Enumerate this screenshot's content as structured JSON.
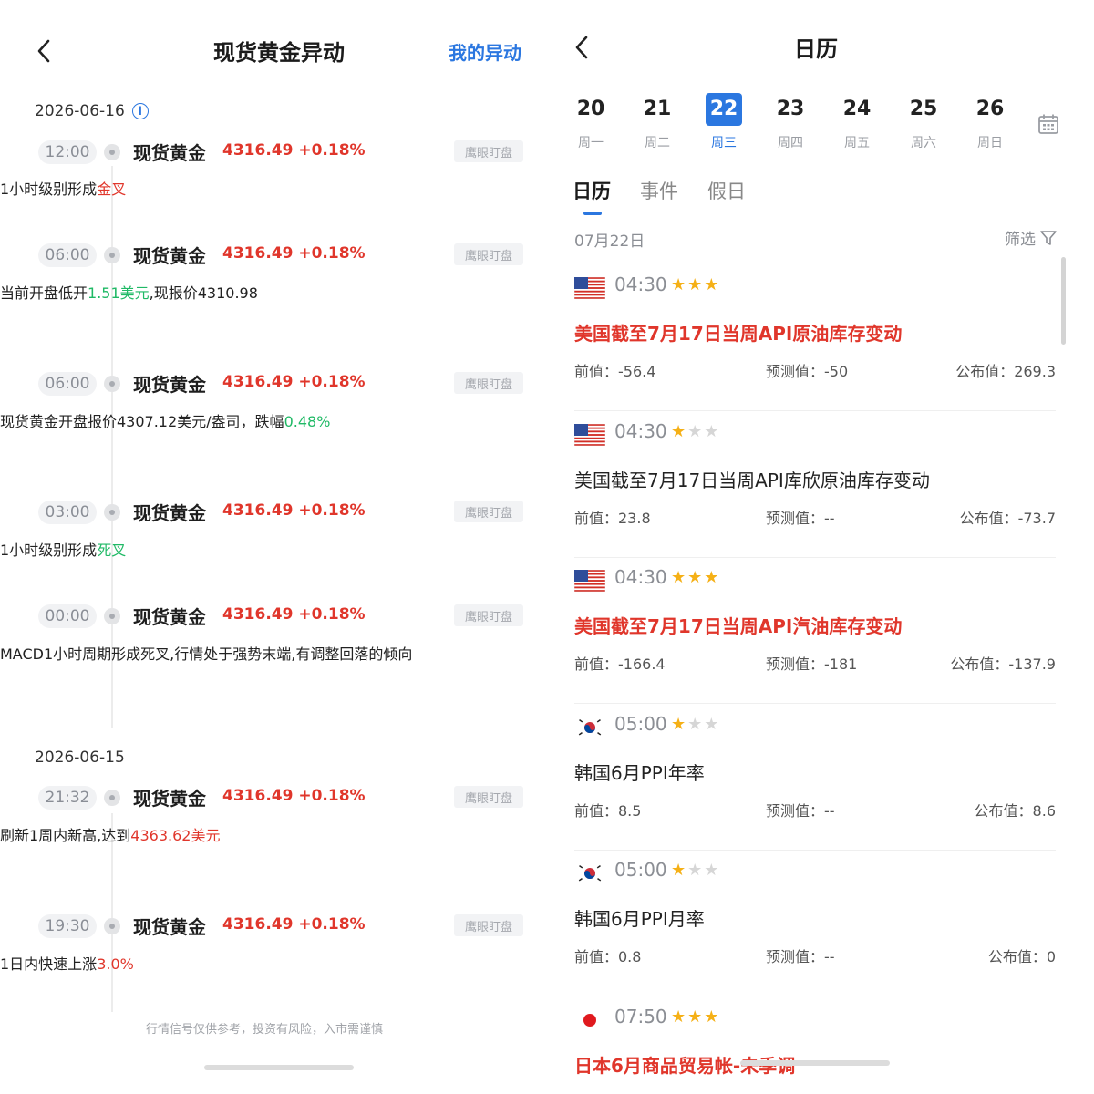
{
  "left": {
    "title": "现货黄金异动",
    "my_changes": "我的异动",
    "disclaimer": "行情信号仅供参考，投资有风险，入市需谨慎",
    "groups": [
      {
        "date": "2026-06-16"
      },
      {
        "date": "2026-06-15"
      }
    ],
    "events": [
      {
        "time": "12:00",
        "name": "现货黄金",
        "price": "4316.49 +0.18%",
        "tag": "鹰眼盯盘",
        "text_a": "1小时级别形成",
        "text_hl": "金叉",
        "text_b": ""
      },
      {
        "time": "06:00",
        "name": "现货黄金",
        "price": "4316.49 +0.18%",
        "tag": "鹰眼盯盘",
        "text_a": "当前开盘低开",
        "text_hl": "1.51美元",
        "text_b": ",现报价4310.98"
      },
      {
        "time": "06:00",
        "name": "现货黄金",
        "price": "4316.49 +0.18%",
        "tag": "鹰眼盯盘",
        "text_a": "现货黄金开盘报价4307.12美元/盎司，跌幅",
        "text_hl": "0.48%",
        "text_b": ""
      },
      {
        "time": "03:00",
        "name": "现货黄金",
        "price": "4316.49 +0.18%",
        "tag": "鹰眼盯盘",
        "text_a": "1小时级别形成",
        "text_hl": "死叉",
        "text_b": ""
      },
      {
        "time": "00:00",
        "name": "现货黄金",
        "price": "4316.49 +0.18%",
        "tag": "鹰眼盯盘",
        "text_a": "MACD1小时周期形成死叉,行情处于强势末端,有调整回落的倾向",
        "text_hl": "",
        "text_b": ""
      },
      {
        "time": "21:32",
        "name": "现货黄金",
        "price": "4316.49 +0.18%",
        "tag": "鹰眼盯盘",
        "text_a": "刷新1周内新高,达到",
        "text_hl": "4363.62美元",
        "text_b": ""
      },
      {
        "time": "19:30",
        "name": "现货黄金",
        "price": "4316.49 +0.18%",
        "tag": "鹰眼盯盘",
        "text_a": "1日内快速上涨",
        "text_hl": "3.0%",
        "text_b": ""
      }
    ]
  },
  "right": {
    "title": "日历",
    "days": [
      {
        "num": "20",
        "week": "周一"
      },
      {
        "num": "21",
        "week": "周二"
      },
      {
        "num": "22",
        "week": "周三"
      },
      {
        "num": "23",
        "week": "周四"
      },
      {
        "num": "24",
        "week": "周五"
      },
      {
        "num": "25",
        "week": "周六"
      },
      {
        "num": "26",
        "week": "周日"
      }
    ],
    "tabs": [
      "日历",
      "事件",
      "假日"
    ],
    "date_label": "07月22日",
    "filter_label": "筛选",
    "items": [
      {
        "flag": "us-flag-icon",
        "time": "04:30",
        "stars": 3,
        "title": "美国截至7月17日当周API原油库存变动",
        "prev": "前值：-56.4",
        "forecast": "预测值：-50",
        "published": "公布值：269.3"
      },
      {
        "flag": "us-flag-icon",
        "time": "04:30",
        "stars": 1,
        "title": "美国截至7月17日当周API库欣原油库存变动",
        "prev": "前值：23.8",
        "forecast": "预测值：--",
        "published": "公布值：-73.7"
      },
      {
        "flag": "us-flag-icon",
        "time": "04:30",
        "stars": 3,
        "title": "美国截至7月17日当周API汽油库存变动",
        "prev": "前值：-166.4",
        "forecast": "预测值：-181",
        "published": "公布值：-137.9"
      },
      {
        "flag": "kr-flag-icon",
        "time": "05:00",
        "stars": 1,
        "title": "韩国6月PPI年率",
        "prev": "前值：8.5",
        "forecast": "预测值：--",
        "published": "公布值：8.6"
      },
      {
        "flag": "kr-flag-icon",
        "time": "05:00",
        "stars": 1,
        "title": "韩国6月PPI月率",
        "prev": "前值：0.8",
        "forecast": "预测值：--",
        "published": "公布值：0"
      },
      {
        "flag": "jp-flag-icon",
        "time": "07:50",
        "stars": 3,
        "title": "日本6月商品贸易帐-未季调",
        "prev": "",
        "forecast": "",
        "published": ""
      }
    ]
  },
  "colors": {
    "accent": "#2b77e0",
    "up_red": "#e0362b",
    "down_green": "#1fb965",
    "star": "#f5b016"
  }
}
